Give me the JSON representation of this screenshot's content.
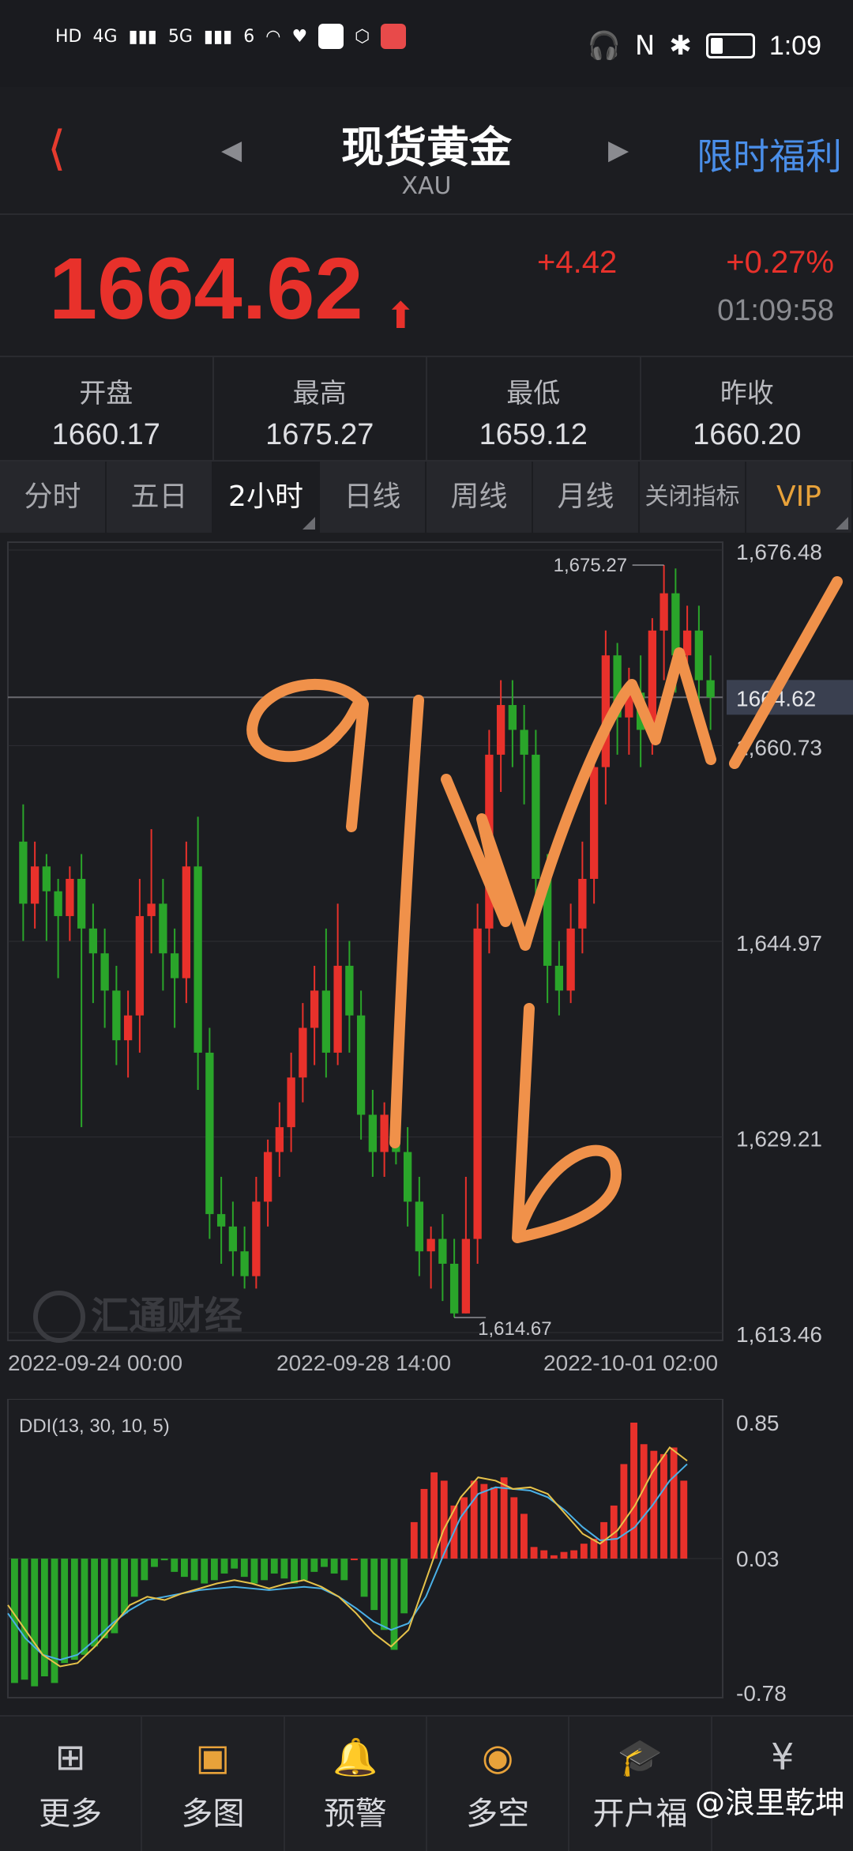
{
  "status_bar": {
    "signal_labels": [
      "HD",
      "4G",
      "5G",
      "6"
    ],
    "clock": "1:09",
    "battery_level": 0.3
  },
  "header": {
    "title": "现货黄金",
    "symbol": "XAU",
    "promo_link": "限时福利"
  },
  "quote": {
    "price": "1664.62",
    "change_abs": "+4.42",
    "change_pct": "+0.27%",
    "timestamp": "01:09:58"
  },
  "stats": [
    {
      "label": "开盘",
      "value": "1660.17"
    },
    {
      "label": "最高",
      "value": "1675.27"
    },
    {
      "label": "最低",
      "value": "1659.12"
    },
    {
      "label": "昨收",
      "value": "1660.20"
    }
  ],
  "tabs": [
    {
      "label": "分时",
      "active": false
    },
    {
      "label": "五日",
      "active": false
    },
    {
      "label": "2小时",
      "active": true
    },
    {
      "label": "日线",
      "active": false
    },
    {
      "label": "周线",
      "active": false
    },
    {
      "label": "月线",
      "active": false
    },
    {
      "label": "关闭指标",
      "active": false
    },
    {
      "label": "VIP",
      "active": false
    }
  ],
  "chart_watermark": "汇通财经",
  "chart_data": [
    {
      "type": "candlestick",
      "y_ticks": [
        "1,676.48",
        "1,660.73",
        "1,644.97",
        "1,629.21",
        "1,613.46"
      ],
      "ylim": [
        1613.46,
        1676.48
      ],
      "current_price_label": "1664.62",
      "current_price": 1664.62,
      "high_annotation": "1,675.27",
      "high_value": 1675.27,
      "low_annotation": "1,614.67",
      "low_value": 1614.67,
      "x_ticks": [
        "2022-09-24 00:00",
        "2022-09-28 14:00",
        "2022-10-01 02:00"
      ],
      "candles": [
        [
          1653,
          1648,
          1656,
          1645
        ],
        [
          1648,
          1651,
          1653,
          1646
        ],
        [
          1651,
          1649,
          1652,
          1645
        ],
        [
          1649,
          1647,
          1650,
          1642
        ],
        [
          1647,
          1650,
          1651,
          1645
        ],
        [
          1650,
          1646,
          1652,
          1630
        ],
        [
          1646,
          1644,
          1648,
          1640
        ],
        [
          1644,
          1641,
          1646,
          1638
        ],
        [
          1641,
          1637,
          1643,
          1635
        ],
        [
          1637,
          1639,
          1641,
          1634
        ],
        [
          1639,
          1647,
          1650,
          1636
        ],
        [
          1647,
          1648,
          1654,
          1644
        ],
        [
          1648,
          1644,
          1650,
          1641
        ],
        [
          1644,
          1642,
          1646,
          1638
        ],
        [
          1642,
          1651,
          1653,
          1640
        ],
        [
          1651,
          1636,
          1655,
          1633
        ],
        [
          1636,
          1623,
          1638,
          1621
        ],
        [
          1623,
          1622,
          1626,
          1619
        ],
        [
          1622,
          1620,
          1624,
          1618
        ],
        [
          1620,
          1618,
          1622,
          1617
        ],
        [
          1618,
          1624,
          1626,
          1617
        ],
        [
          1624,
          1628,
          1629,
          1622
        ],
        [
          1628,
          1630,
          1632,
          1626
        ],
        [
          1630,
          1634,
          1636,
          1628
        ],
        [
          1634,
          1638,
          1640,
          1632
        ],
        [
          1638,
          1641,
          1643,
          1635
        ],
        [
          1641,
          1636,
          1646,
          1634
        ],
        [
          1636,
          1643,
          1648,
          1635
        ],
        [
          1643,
          1639,
          1645,
          1636
        ],
        [
          1639,
          1631,
          1641,
          1629
        ],
        [
          1631,
          1628,
          1633,
          1626
        ],
        [
          1628,
          1631,
          1632,
          1626
        ],
        [
          1631,
          1628,
          1633,
          1627
        ],
        [
          1628,
          1624,
          1630,
          1622
        ],
        [
          1624,
          1620,
          1626,
          1618
        ],
        [
          1620,
          1621,
          1622,
          1617
        ],
        [
          1621,
          1619,
          1623,
          1616
        ],
        [
          1619,
          1615,
          1621,
          1614.67
        ],
        [
          1615,
          1621,
          1626,
          1615
        ],
        [
          1621,
          1646,
          1648,
          1619
        ],
        [
          1646,
          1660,
          1662,
          1644
        ],
        [
          1660,
          1664,
          1666,
          1657
        ],
        [
          1664,
          1662,
          1666,
          1659
        ],
        [
          1662,
          1660,
          1664,
          1656
        ],
        [
          1660,
          1650,
          1662,
          1648
        ],
        [
          1650,
          1643,
          1652,
          1640
        ],
        [
          1643,
          1641,
          1645,
          1639
        ],
        [
          1641,
          1646,
          1648,
          1640
        ],
        [
          1646,
          1650,
          1653,
          1644
        ],
        [
          1650,
          1659,
          1661,
          1648
        ],
        [
          1659,
          1668,
          1670,
          1656
        ],
        [
          1668,
          1663,
          1669,
          1660
        ],
        [
          1663,
          1665,
          1667,
          1660
        ],
        [
          1665,
          1662,
          1668,
          1659
        ],
        [
          1662,
          1670,
          1671,
          1660
        ],
        [
          1670,
          1673,
          1675.27,
          1666
        ],
        [
          1673,
          1668,
          1675,
          1665
        ],
        [
          1668,
          1670,
          1672,
          1665
        ],
        [
          1670,
          1666,
          1672,
          1663
        ],
        [
          1666,
          1664.62,
          1668,
          1662
        ]
      ]
    },
    {
      "type": "bar",
      "title": "DDI(13, 30, 10, 5)",
      "y_ticks": [
        "0.85",
        "0.03",
        "-0.78"
      ],
      "ylim": [
        -0.78,
        0.85
      ],
      "values": [
        -0.72,
        -0.7,
        -0.74,
        -0.68,
        -0.72,
        -0.6,
        -0.58,
        -0.55,
        -0.5,
        -0.45,
        -0.42,
        -0.3,
        -0.2,
        -0.1,
        -0.02,
        0.02,
        -0.05,
        -0.08,
        -0.1,
        -0.12,
        -0.1,
        -0.06,
        -0.03,
        -0.08,
        -0.12,
        -0.1,
        -0.06,
        -0.09,
        -0.12,
        -0.1,
        -0.05,
        -0.02,
        -0.06,
        -0.1,
        0.03,
        -0.2,
        -0.28,
        -0.4,
        -0.52,
        -0.3,
        0.25,
        0.45,
        0.55,
        0.5,
        0.35,
        0.4,
        0.5,
        0.48,
        0.46,
        0.52,
        0.4,
        0.3,
        0.1,
        0.08,
        0.05,
        0.07,
        0.08,
        0.12,
        0.15,
        0.25,
        0.35,
        0.6,
        0.85,
        0.72,
        0.68,
        0.66,
        0.7,
        0.5
      ],
      "line_fast": [
        -0.25,
        -0.4,
        -0.55,
        -0.62,
        -0.6,
        -0.5,
        -0.38,
        -0.25,
        -0.2,
        -0.22,
        -0.18,
        -0.15,
        -0.12,
        -0.1,
        -0.12,
        -0.15,
        -0.12,
        -0.1,
        -0.14,
        -0.2,
        -0.3,
        -0.42,
        -0.5,
        -0.4,
        -0.1,
        0.2,
        0.4,
        0.52,
        0.5,
        0.45,
        0.46,
        0.42,
        0.3,
        0.18,
        0.12,
        0.2,
        0.35,
        0.55,
        0.7,
        0.62
      ],
      "line_slow": [
        -0.3,
        -0.45,
        -0.55,
        -0.58,
        -0.55,
        -0.46,
        -0.36,
        -0.28,
        -0.22,
        -0.2,
        -0.18,
        -0.16,
        -0.15,
        -0.14,
        -0.15,
        -0.16,
        -0.15,
        -0.14,
        -0.15,
        -0.2,
        -0.27,
        -0.35,
        -0.4,
        -0.36,
        -0.2,
        0.05,
        0.28,
        0.42,
        0.46,
        0.45,
        0.44,
        0.4,
        0.32,
        0.22,
        0.14,
        0.15,
        0.22,
        0.35,
        0.5,
        0.6
      ]
    }
  ],
  "bottom_nav": [
    {
      "label": "更多",
      "icon": "grid-icon"
    },
    {
      "label": "多图",
      "icon": "multi-chart-icon"
    },
    {
      "label": "预警",
      "icon": "bell-icon"
    },
    {
      "label": "多空",
      "icon": "long-short-icon"
    },
    {
      "label": "开户福",
      "icon": "account-gift-icon"
    },
    {
      "label": "",
      "icon": "money-bag-icon"
    }
  ],
  "footer_watermark": "@浪里乾坤",
  "handwriting": [
    "a",
    "b"
  ],
  "colors": {
    "up": "#e8312b",
    "down": "#2aa52a",
    "accent": "#4a8ee8",
    "vip": "#e8a23a",
    "annotation": "#f0914a"
  }
}
